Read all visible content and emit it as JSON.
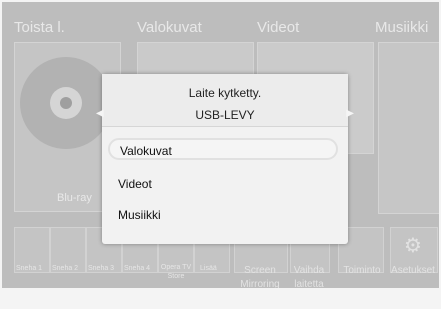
{
  "categories": [
    "Toista l.",
    "Valokuvat",
    "Videot",
    "Musiikki"
  ],
  "play_panel": {
    "disc_label": "Blu-ray"
  },
  "bottom_row": {
    "small_tiles": [
      "Sneha 1",
      "Sneha 2",
      "Sneha 3",
      "Sneha 4"
    ],
    "store": "Opera TV Store",
    "add": "Lisää",
    "screen_mirroring": "Screen Mirroring",
    "switch_device": "Vaihda laitetta",
    "action": "Toiminto",
    "settings": "Asetukset"
  },
  "dialog": {
    "title": "Laite kytketty.",
    "device": "USB-LEVY",
    "items": [
      "Valokuvat",
      "Videot",
      "Musiikki"
    ],
    "selected_index": 0
  },
  "icons": [
    "chevron-left-icon",
    "chevron-right-icon",
    "gear-icon",
    "plus-icon"
  ]
}
